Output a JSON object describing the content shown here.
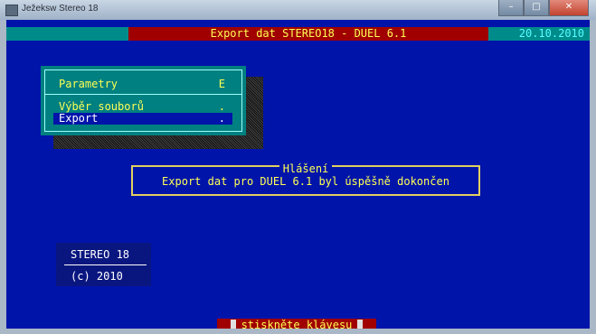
{
  "window": {
    "title": "Ježeksw Stereo 18",
    "controls": {
      "minimize": "–",
      "maximize": "□",
      "close": "✕"
    }
  },
  "header": {
    "title": "Export dat STEREO18 - DUEL 6.1",
    "date": "20.10.2010"
  },
  "menu": {
    "items": [
      {
        "label": "Parametry",
        "shortcut": "E"
      },
      {
        "label": "Výběr souborů",
        "shortcut": "."
      },
      {
        "label": "Export",
        "shortcut": "."
      }
    ],
    "selected": "Export"
  },
  "message": {
    "title": "Hlášení",
    "text": "Export dat pro DUEL 6.1 byl úspěšně dokončen"
  },
  "about": {
    "product": "STEREO 18",
    "copyright": "(c)  2010"
  },
  "status": {
    "prompt": "stiskněte klávesu"
  },
  "colors": {
    "console_bg": "#0014aa",
    "bar_red": "#a00000",
    "bar_cyan": "#008b8b",
    "text_yellow": "#ffff55",
    "menu_teal": "#008080"
  }
}
